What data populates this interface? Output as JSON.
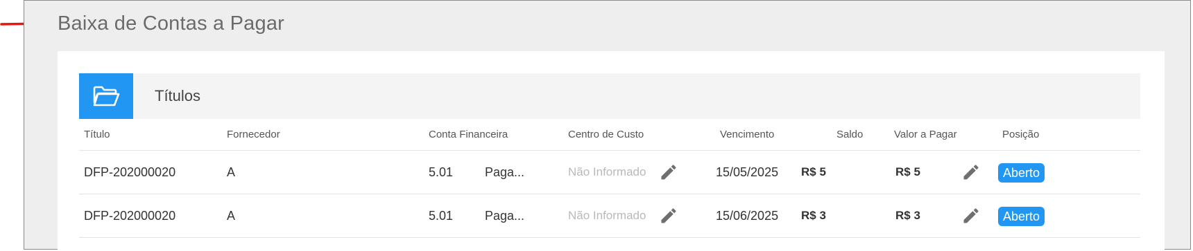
{
  "page": {
    "title": "Baixa de Contas a Pagar"
  },
  "panel": {
    "title": "Títulos",
    "icon": "folder-open-icon"
  },
  "table": {
    "columns": [
      "Título",
      "Fornecedor",
      "Conta Financeira",
      "Centro de Custo",
      "Vencimento",
      "Saldo",
      "Valor a Pagar",
      "Posição"
    ],
    "rows": [
      {
        "titulo": "DFP-202000020",
        "fornecedor": "A",
        "conta_codigo": "5.01",
        "conta_nome": "Paga...",
        "centro_custo": "Não Informado",
        "vencimento": "15/05/2025",
        "saldo": "R$ 5",
        "valor_pagar": "R$ 5",
        "posicao": "Aberto"
      },
      {
        "titulo": "DFP-202000020",
        "fornecedor": "A",
        "conta_codigo": "5.01",
        "conta_nome": "Paga...",
        "centro_custo": "Não Informado",
        "vencimento": "15/06/2025",
        "saldo": "R$ 3",
        "valor_pagar": "R$ 3",
        "posicao": "Aberto"
      }
    ]
  },
  "colors": {
    "accent": "#2196f3",
    "annotation_arrow": "#e8140f"
  }
}
